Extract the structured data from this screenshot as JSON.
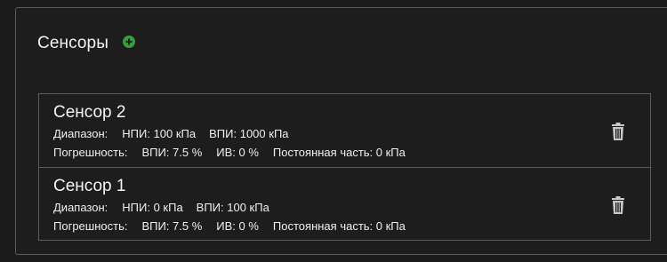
{
  "panel": {
    "title": "Сенсоры",
    "add_icon": "plus-circle-icon",
    "add_icon_color": "#3a9d3a"
  },
  "sensors": [
    {
      "name": "Сенсор 2",
      "range_label": "Диапазон:",
      "npi": "НПИ: 100 кПа",
      "vpi": "ВПИ: 1000 кПа",
      "error_label": "Погрешность:",
      "error_vpi": "ВПИ: 7.5 %",
      "error_iv": "ИВ: 0 %",
      "error_const": "Постоянная часть: 0 кПа",
      "delete_icon": "trash-icon"
    },
    {
      "name": "Сенсор 1",
      "range_label": "Диапазон:",
      "npi": "НПИ: 0 кПа",
      "vpi": "ВПИ: 100 кПа",
      "error_label": "Погрешность:",
      "error_vpi": "ВПИ: 7.5 %",
      "error_iv": "ИВ: 0 %",
      "error_const": "Постоянная часть: 0 кПа",
      "delete_icon": "trash-icon"
    }
  ],
  "colors": {
    "background": "#1b1b1b",
    "border": "#5c5c5c",
    "text": "#f2f2f2",
    "icon_gray": "#c8c8c8"
  }
}
